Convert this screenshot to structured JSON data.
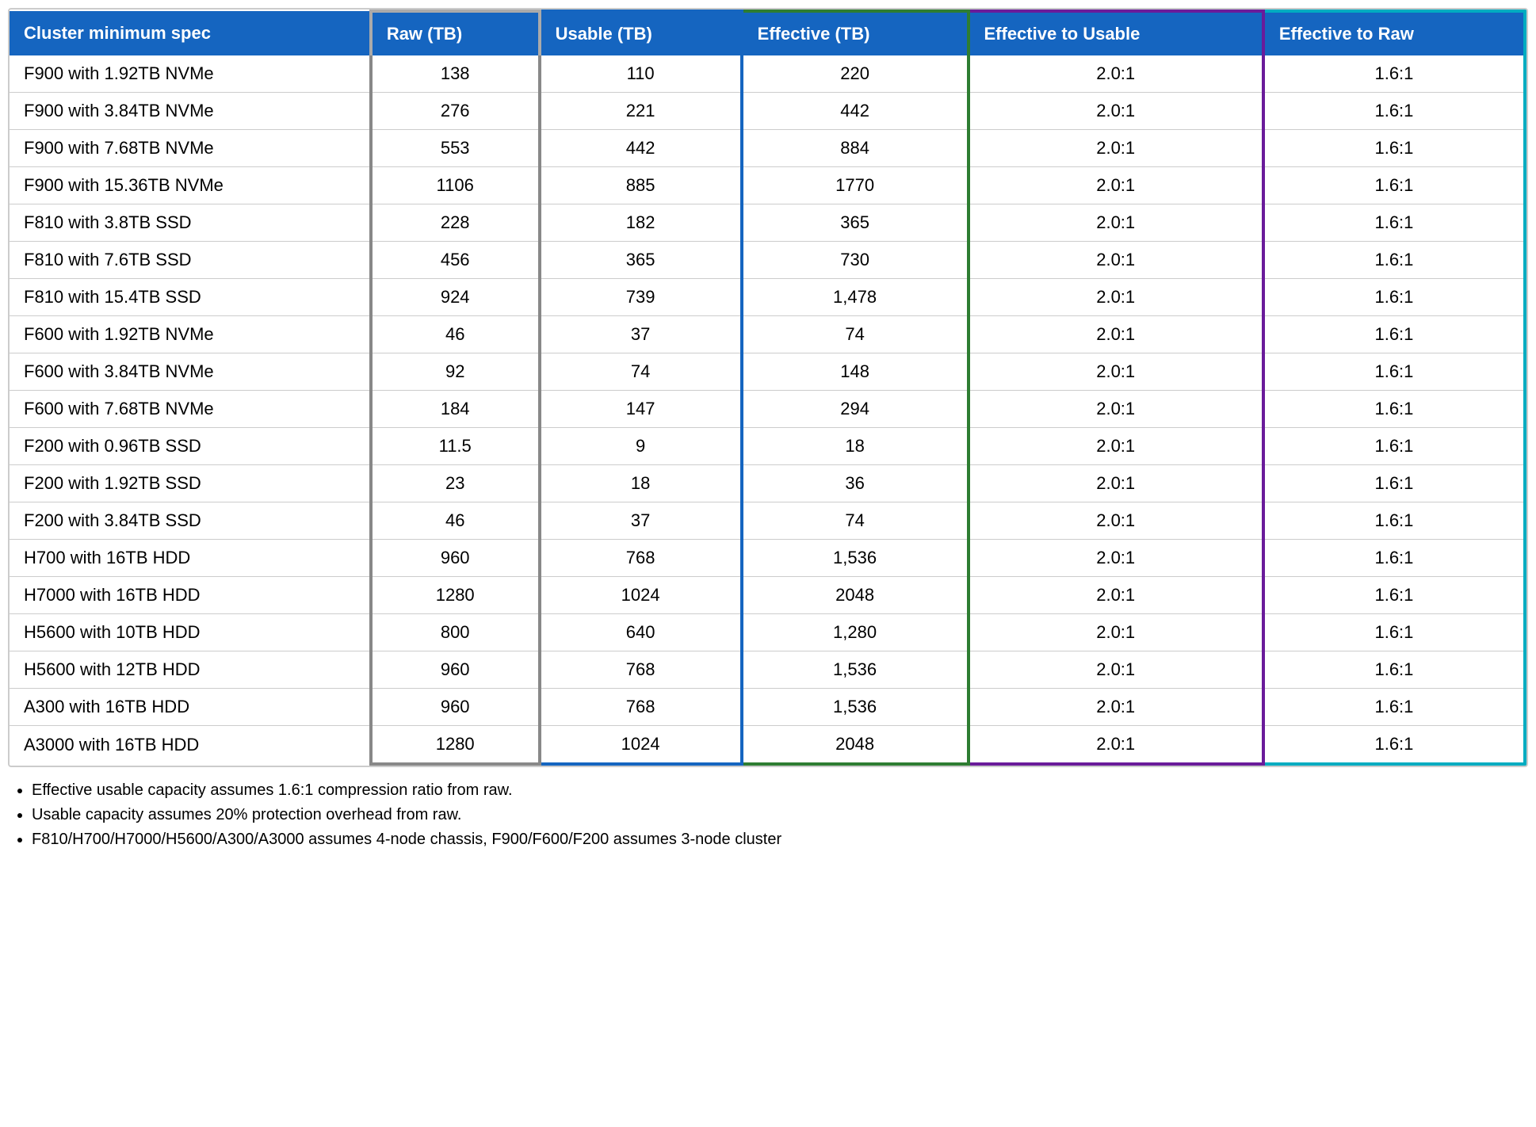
{
  "table": {
    "headers": [
      {
        "key": "spec",
        "label": "Cluster minimum spec",
        "colClass": ""
      },
      {
        "key": "raw",
        "label": "Raw (TB)",
        "colClass": "col-raw"
      },
      {
        "key": "usable",
        "label": "Usable (TB)",
        "colClass": "col-usable"
      },
      {
        "key": "effective",
        "label": "Effective (TB)",
        "colClass": "col-effective"
      },
      {
        "key": "eff_usable",
        "label": "Effective to Usable",
        "colClass": "col-eff-usable"
      },
      {
        "key": "eff_raw",
        "label": "Effective to Raw",
        "colClass": "col-eff-raw"
      }
    ],
    "rows": [
      {
        "spec": "F900 with 1.92TB NVMe",
        "raw": "138",
        "usable": "110",
        "effective": "220",
        "eff_usable": "2.0:1",
        "eff_raw": "1.6:1"
      },
      {
        "spec": "F900 with 3.84TB NVMe",
        "raw": "276",
        "usable": "221",
        "effective": "442",
        "eff_usable": "2.0:1",
        "eff_raw": "1.6:1"
      },
      {
        "spec": "F900 with 7.68TB NVMe",
        "raw": "553",
        "usable": "442",
        "effective": "884",
        "eff_usable": "2.0:1",
        "eff_raw": "1.6:1"
      },
      {
        "spec": "F900 with 15.36TB NVMe",
        "raw": "1106",
        "usable": "885",
        "effective": "1770",
        "eff_usable": "2.0:1",
        "eff_raw": "1.6:1"
      },
      {
        "spec": "F810 with 3.8TB SSD",
        "raw": "228",
        "usable": "182",
        "effective": "365",
        "eff_usable": "2.0:1",
        "eff_raw": "1.6:1"
      },
      {
        "spec": "F810 with 7.6TB SSD",
        "raw": "456",
        "usable": "365",
        "effective": "730",
        "eff_usable": "2.0:1",
        "eff_raw": "1.6:1"
      },
      {
        "spec": "F810 with 15.4TB SSD",
        "raw": "924",
        "usable": "739",
        "effective": "1,478",
        "eff_usable": "2.0:1",
        "eff_raw": "1.6:1"
      },
      {
        "spec": "F600 with 1.92TB NVMe",
        "raw": "46",
        "usable": "37",
        "effective": "74",
        "eff_usable": "2.0:1",
        "eff_raw": "1.6:1"
      },
      {
        "spec": "F600 with 3.84TB NVMe",
        "raw": "92",
        "usable": "74",
        "effective": "148",
        "eff_usable": "2.0:1",
        "eff_raw": "1.6:1"
      },
      {
        "spec": "F600 with 7.68TB NVMe",
        "raw": "184",
        "usable": "147",
        "effective": "294",
        "eff_usable": "2.0:1",
        "eff_raw": "1.6:1"
      },
      {
        "spec": "F200 with 0.96TB SSD",
        "raw": "11.5",
        "usable": "9",
        "effective": "18",
        "eff_usable": "2.0:1",
        "eff_raw": "1.6:1"
      },
      {
        "spec": "F200 with 1.92TB SSD",
        "raw": "23",
        "usable": "18",
        "effective": "36",
        "eff_usable": "2.0:1",
        "eff_raw": "1.6:1"
      },
      {
        "spec": "F200 with 3.84TB SSD",
        "raw": "46",
        "usable": "37",
        "effective": "74",
        "eff_usable": "2.0:1",
        "eff_raw": "1.6:1"
      },
      {
        "spec": "H700 with 16TB HDD",
        "raw": "960",
        "usable": "768",
        "effective": "1,536",
        "eff_usable": "2.0:1",
        "eff_raw": "1.6:1"
      },
      {
        "spec": "H7000 with 16TB HDD",
        "raw": "1280",
        "usable": "1024",
        "effective": "2048",
        "eff_usable": "2.0:1",
        "eff_raw": "1.6:1"
      },
      {
        "spec": "H5600 with 10TB HDD",
        "raw": "800",
        "usable": "640",
        "effective": "1,280",
        "eff_usable": "2.0:1",
        "eff_raw": "1.6:1"
      },
      {
        "spec": "H5600 with 12TB HDD",
        "raw": "960",
        "usable": "768",
        "effective": "1,536",
        "eff_usable": "2.0:1",
        "eff_raw": "1.6:1"
      },
      {
        "spec": "A300 with 16TB HDD",
        "raw": "960",
        "usable": "768",
        "effective": "1,536",
        "eff_usable": "2.0:1",
        "eff_raw": "1.6:1"
      },
      {
        "spec": "A3000 with 16TB HDD",
        "raw": "1280",
        "usable": "1024",
        "effective": "2048",
        "eff_usable": "2.0:1",
        "eff_raw": "1.6:1"
      }
    ]
  },
  "notes": [
    "Effective usable capacity assumes 1.6:1 compression ratio from raw.",
    "Usable capacity assumes 20% protection overhead from raw.",
    "F810/H700/H7000/H5600/A300/A3000 assumes 4-node chassis, F900/F600/F200 assumes 3-node cluster"
  ]
}
